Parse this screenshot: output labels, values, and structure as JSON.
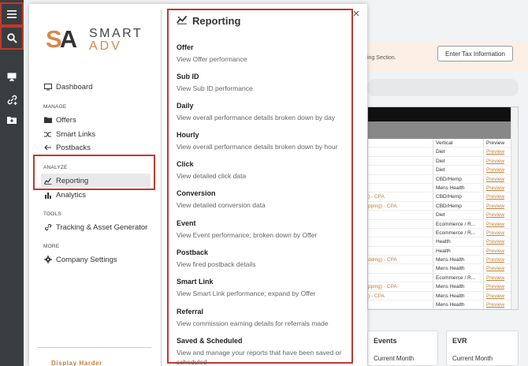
{
  "rail": {
    "items": [
      {
        "icon": "hamburger-menu-icon"
      },
      {
        "icon": "search-icon"
      },
      {
        "icon": "monitor-icon"
      },
      {
        "icon": "link-add-icon"
      },
      {
        "icon": "folder-plus-icon"
      }
    ]
  },
  "background": {
    "tax_notice_text": "ing Section.",
    "tax_button_label": "Enter Tax Information",
    "table": {
      "col_vertical": "Vertical",
      "col_preview": "Preview",
      "rows": [
        {
          "c1": "",
          "c2": "Diet",
          "c3": "Preview"
        },
        {
          "c1": "",
          "c2": "Diet",
          "c3": "Preview"
        },
        {
          "c1": "",
          "c2": "Diet",
          "c3": "Preview"
        },
        {
          "c1": "",
          "c2": "CBD/Hemp",
          "c3": "Preview"
        },
        {
          "c1": "",
          "c2": "Mens Health",
          "c3": "Preview"
        },
        {
          "c1": ") - CPA",
          "c2": "CBD/Hemp",
          "c3": "Preview"
        },
        {
          "c1": "pping) - CPA",
          "c2": "CBD/Hemp",
          "c3": "Preview"
        },
        {
          "c1": "",
          "c2": "Diet",
          "c3": "Preview"
        },
        {
          "c1": "",
          "c2": "Ecommerce / R...",
          "c3": "Preview"
        },
        {
          "c1": "",
          "c2": "Ecommerce / R...",
          "c3": "Preview"
        },
        {
          "c1": "",
          "c2": "Health",
          "c3": "Preview"
        },
        {
          "c1": "",
          "c2": "Health",
          "c3": "Preview"
        },
        {
          "c1": "dding) - CPA",
          "c2": "Mens Health",
          "c3": "Preview"
        },
        {
          "c1": "",
          "c2": "Mens Health",
          "c3": "Preview"
        },
        {
          "c1": "",
          "c2": "Ecommerce / R...",
          "c3": "Preview"
        },
        {
          "c1": "pping) - CPA",
          "c2": "Mens Health",
          "c3": "Preview"
        },
        {
          "c1": ") - CPA",
          "c2": "Mens Health",
          "c3": "Preview"
        },
        {
          "c1": "",
          "c2": "Mens Health",
          "c3": "Preview"
        }
      ]
    },
    "cards": [
      {
        "title": "Events",
        "sub": "Current Month"
      },
      {
        "title": "EVR",
        "sub": "Current Month"
      }
    ]
  },
  "logo": {
    "monogram_s": "S",
    "monogram_a": "A",
    "word_top": "SMART",
    "word_bottom": "ADV"
  },
  "nav": {
    "dashboard": "Dashboard",
    "manage_section": "MANAGE",
    "offers": "Offers",
    "smart_links": "Smart Links",
    "postbacks": "Postbacks",
    "analyze_section": "ANALYZE",
    "reporting": "Reporting",
    "analytics": "Analytics",
    "tools_section": "TOOLS",
    "tracking": "Tracking & Asset Generator",
    "more_section": "MORE",
    "company_settings": "Company Settings",
    "display_harder": "Display Harder"
  },
  "reporting_menu": {
    "title": "Reporting",
    "items": [
      {
        "name": "Offer",
        "desc": "View Offer performance"
      },
      {
        "name": "Sub ID",
        "desc": "View Sub ID performance"
      },
      {
        "name": "Daily",
        "desc": "View overall performance details broken down by day"
      },
      {
        "name": "Hourly",
        "desc": "View overall performance details broken down by hour"
      },
      {
        "name": "Click",
        "desc": "View detailed click data"
      },
      {
        "name": "Conversion",
        "desc": "View detailed conversion data"
      },
      {
        "name": "Event",
        "desc": "View Event performance; broken down by Offer"
      },
      {
        "name": "Postback",
        "desc": "View fired postback details"
      },
      {
        "name": "Smart Link",
        "desc": "View Smart Link performance; expand by Offer"
      },
      {
        "name": "Referral",
        "desc": "View commission earning details for referrals made"
      },
      {
        "name": "Saved & Scheduled",
        "desc": "View and manage your reports that have been saved or scheduled"
      }
    ]
  },
  "colors": {
    "rail_bg": "#3a3d40",
    "accent": "#d48a49",
    "highlight": "#c0392b"
  }
}
